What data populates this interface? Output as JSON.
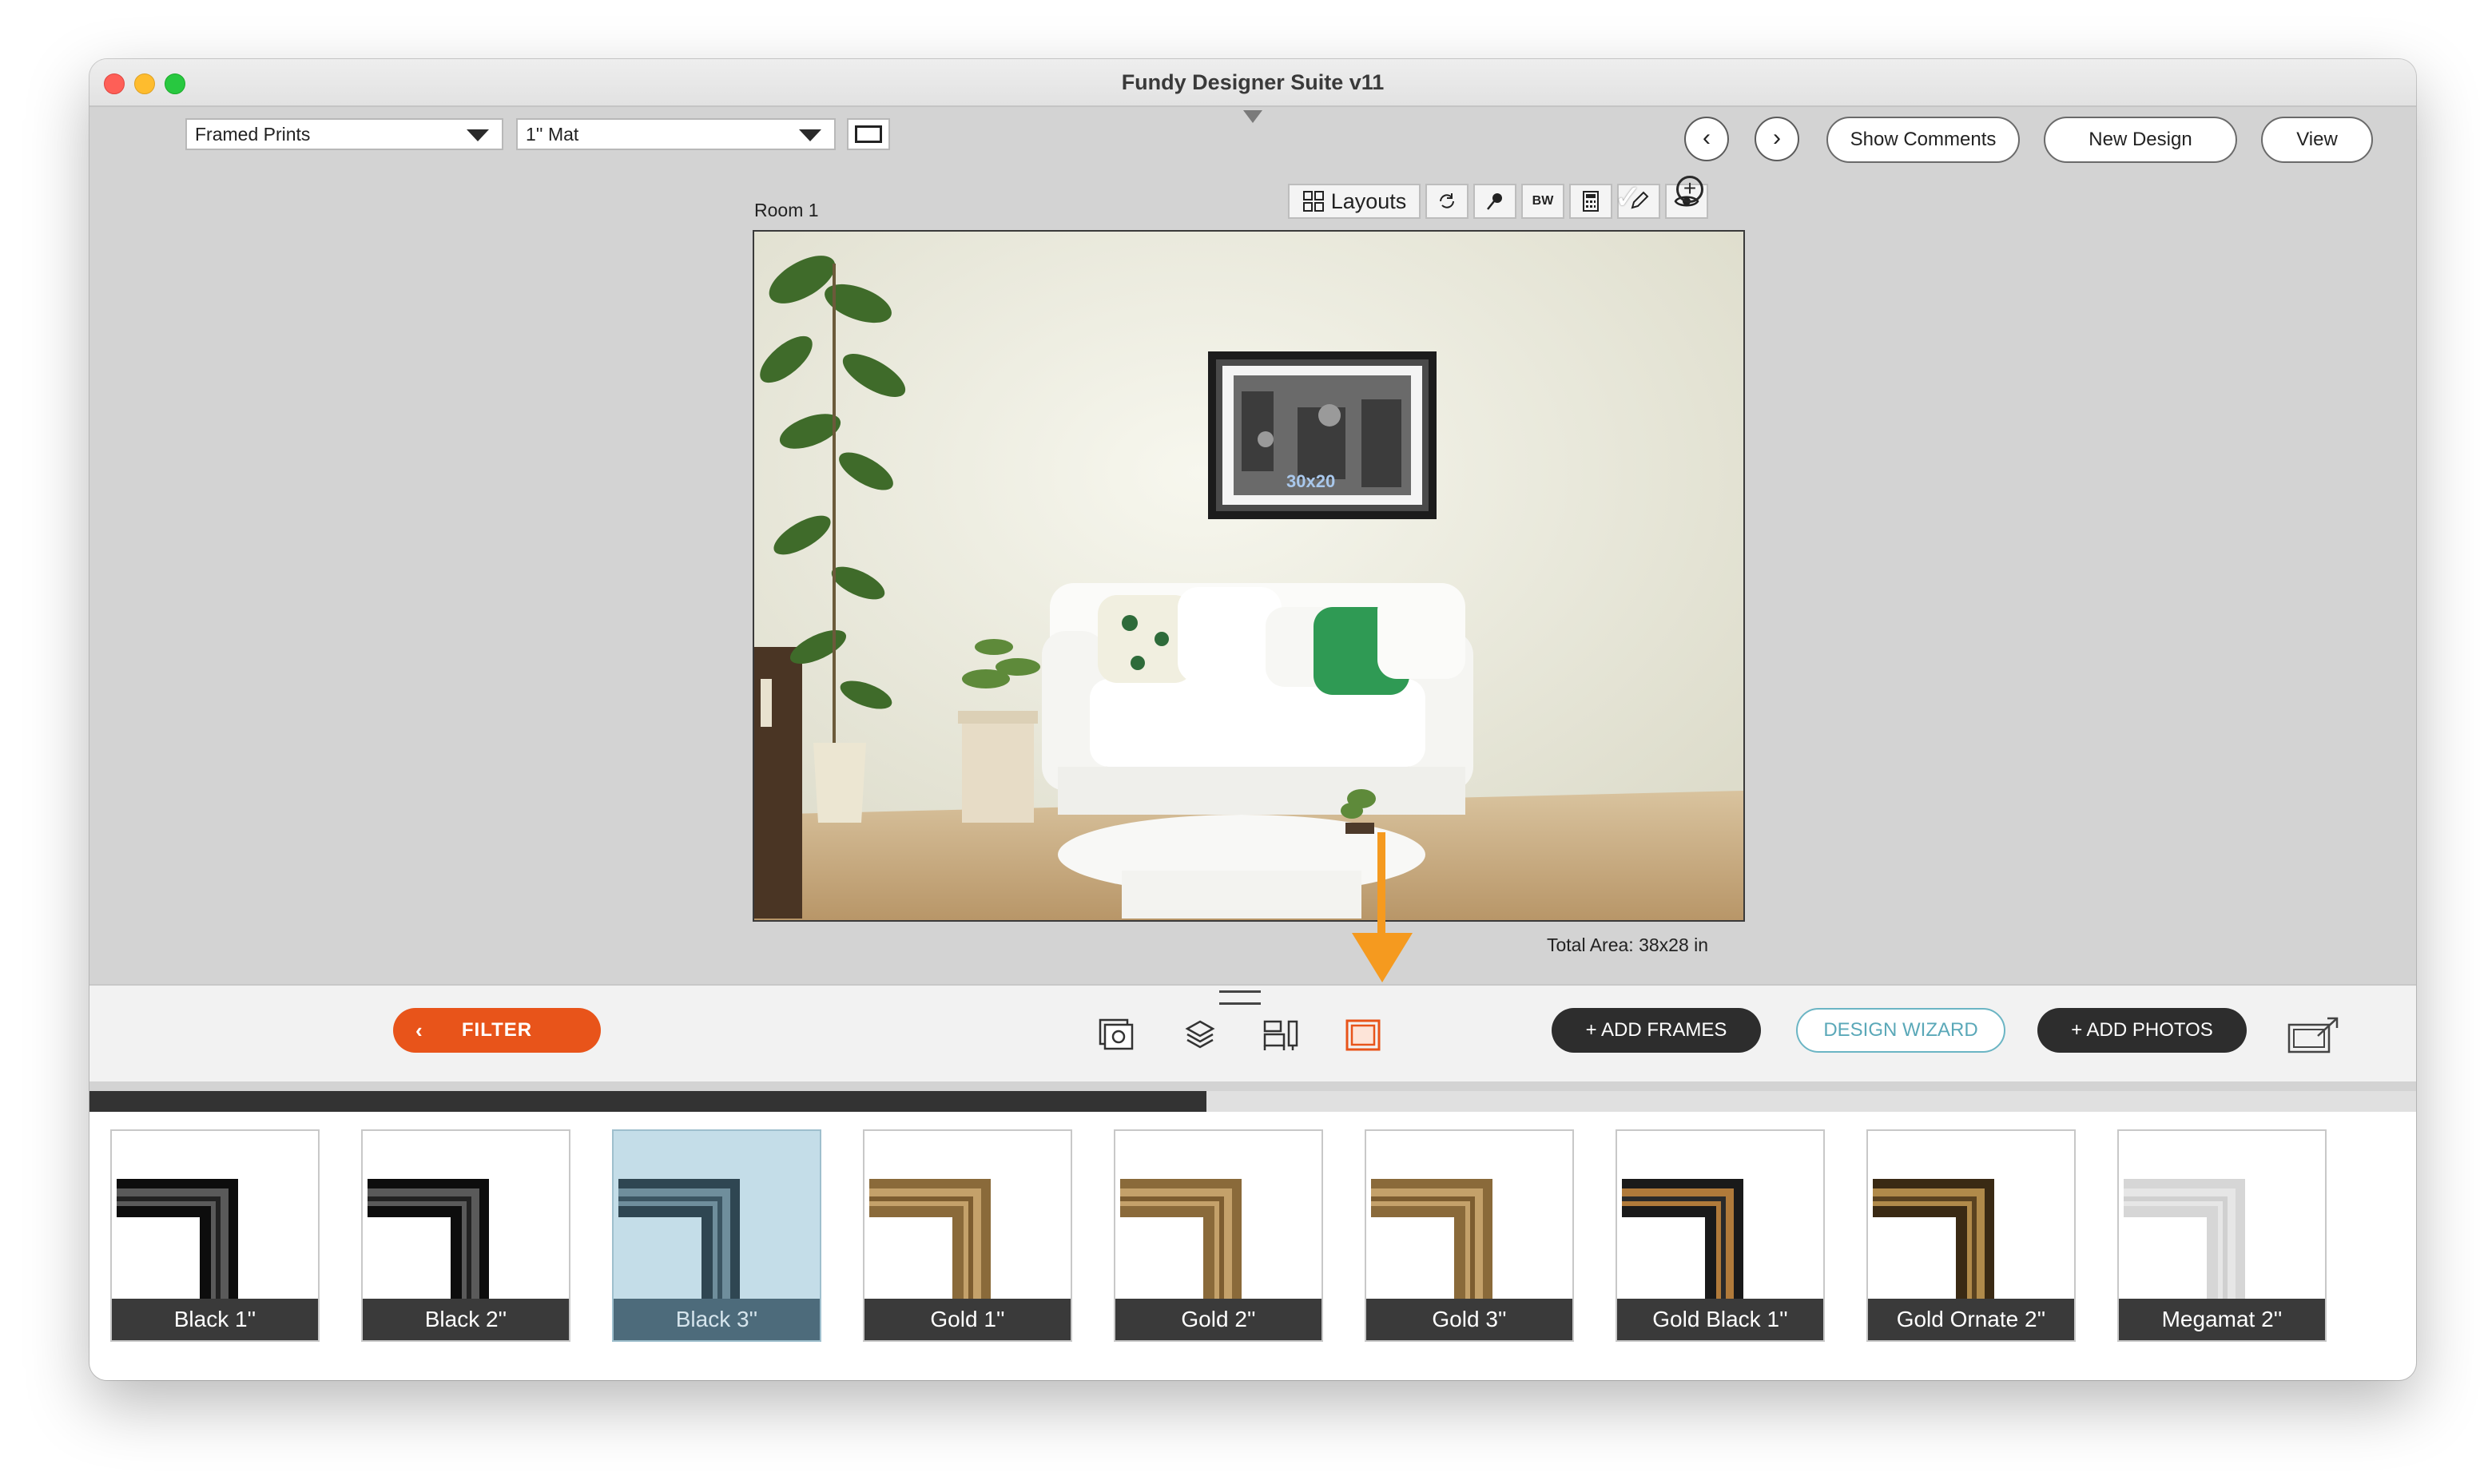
{
  "window": {
    "title": "Fundy Designer Suite v11"
  },
  "top_controls": {
    "product_select": "Framed Prints",
    "mat_select": "1'' Mat",
    "prev_label": "‹",
    "next_label": "›",
    "show_comments": "Show Comments",
    "new_design": "New Design",
    "view": "View"
  },
  "room": {
    "label": "Room 1",
    "print_size": "30x20",
    "total_area": "Total Area: 38x28 in"
  },
  "toolbar": {
    "layouts_label": "Layouts",
    "bw_label": "BW"
  },
  "bottom_bar": {
    "filter_label": "FILTER",
    "add_frames": "+ ADD FRAMES",
    "design_wizard": "DESIGN WIZARD",
    "add_photos": "+ ADD PHOTOS"
  },
  "progress": {
    "fraction": 0.48
  },
  "frames": [
    {
      "label": "Black 1''",
      "style": "black",
      "selected": false
    },
    {
      "label": "Black 2''",
      "style": "black",
      "selected": false
    },
    {
      "label": "Black 3''",
      "style": "slate",
      "selected": true
    },
    {
      "label": "Gold 1''",
      "style": "gold",
      "selected": false
    },
    {
      "label": "Gold 2''",
      "style": "gold",
      "selected": false
    },
    {
      "label": "Gold 3''",
      "style": "gold",
      "selected": false
    },
    {
      "label": "Gold Black 1''",
      "style": "goldblack",
      "selected": false
    },
    {
      "label": "Gold Ornate 2''",
      "style": "ornate",
      "selected": false
    },
    {
      "label": "Megamat 2''",
      "style": "megamat",
      "selected": false
    }
  ],
  "colors": {
    "accent_orange": "#e8541a",
    "arrow_orange": "#f59a1f",
    "wizard_teal": "#5aa8b8",
    "selected_tile": "#c4dde8"
  }
}
